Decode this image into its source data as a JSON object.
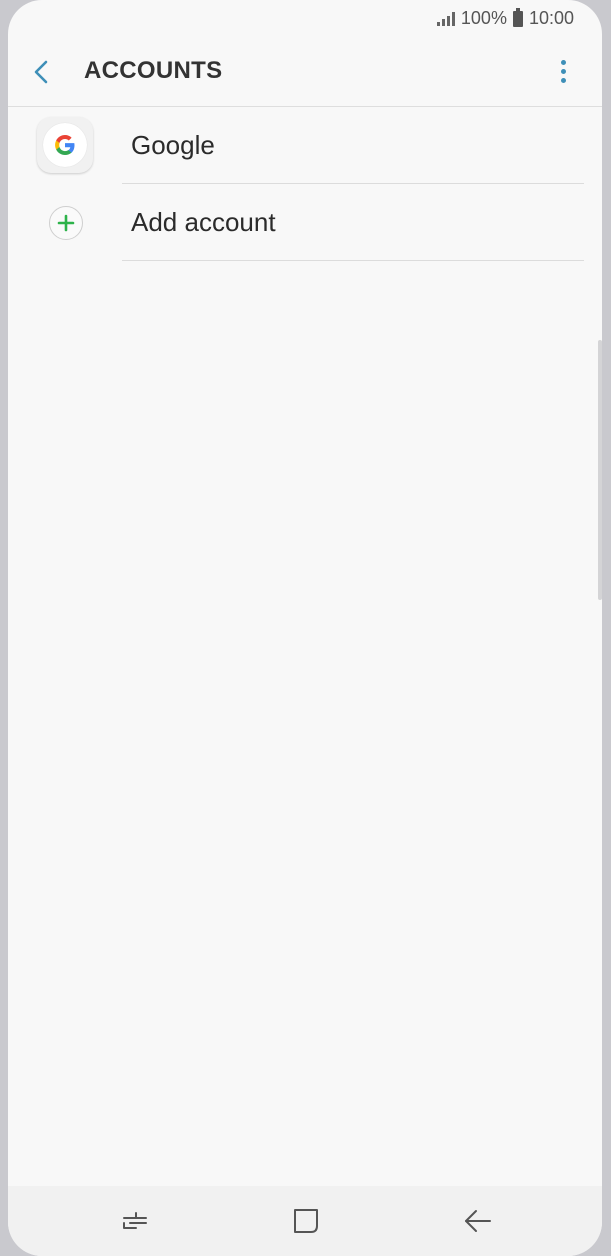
{
  "status_bar": {
    "battery_percent": "100%",
    "time": "10:00",
    "signal_icon": "signal-icon",
    "battery_icon": "battery-icon"
  },
  "app_bar": {
    "title": "ACCOUNTS",
    "back_icon": "chevron-left-icon",
    "more_icon": "more-vertical-icon",
    "accent_color": "#3e8fb8"
  },
  "accounts": {
    "items": [
      {
        "label": "Google",
        "icon": "google-icon"
      },
      {
        "label": "Add account",
        "icon": "add-circle-icon",
        "icon_color": "#2db34a"
      }
    ]
  },
  "nav_bar": {
    "recents_icon": "recent-apps-icon",
    "home_icon": "home-icon",
    "back_icon": "back-arrow-icon"
  }
}
